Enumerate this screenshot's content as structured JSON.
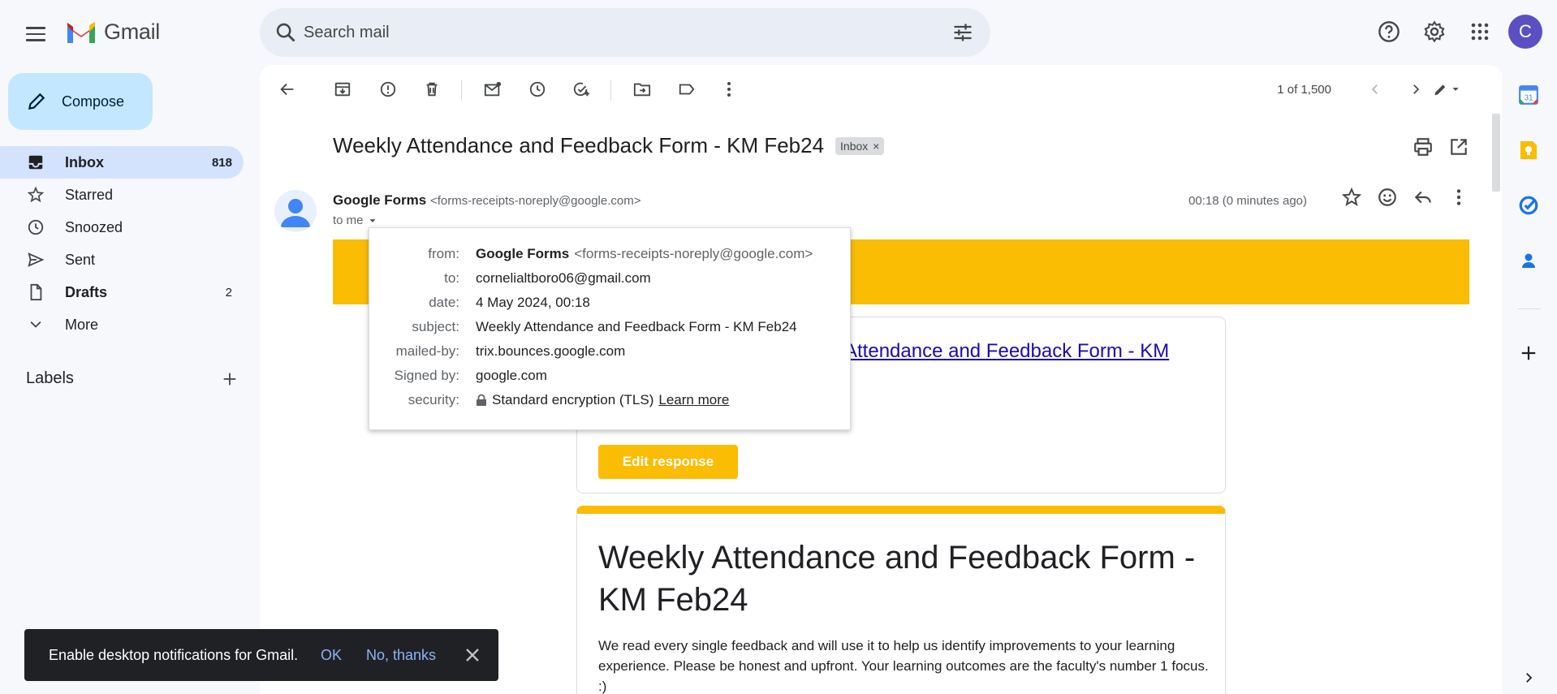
{
  "app": {
    "logo_text": "Gmail"
  },
  "search": {
    "placeholder": "Search mail"
  },
  "account": {
    "initial": "C"
  },
  "compose": {
    "label": "Compose"
  },
  "nav": {
    "items": [
      {
        "label": "Inbox",
        "count": "818",
        "icon": "inbox-icon"
      },
      {
        "label": "Starred",
        "count": "",
        "icon": "star-icon"
      },
      {
        "label": "Snoozed",
        "count": "",
        "icon": "clock-icon"
      },
      {
        "label": "Sent",
        "count": "",
        "icon": "send-icon"
      },
      {
        "label": "Drafts",
        "count": "2",
        "icon": "draft-icon"
      },
      {
        "label": "More",
        "count": "",
        "icon": "chevron-down-icon"
      }
    ],
    "labels_heading": "Labels"
  },
  "toolbar": {
    "pager": "1 of 1,500"
  },
  "email": {
    "subject": "Weekly Attendance and Feedback Form - KM Feb24",
    "label_chip": "Inbox",
    "sender_name": "Google Forms",
    "sender_email": "<forms-receipts-noreply@google.com>",
    "to_line": "to me",
    "time": "00:18 (0 minutes ago)",
    "link_text": "Attendance and Feedback Form - KM",
    "edit_button": "Edit response",
    "form_title": "Weekly Attendance and Feedback Form - KM Feb24",
    "form_description": "We read every single feedback and will use it to help us identify improvements to your learning experience. Please be honest and upfront. Your learning outcomes are the faculty's number 1 focus. :)"
  },
  "details": {
    "from_label": "from:",
    "from_name": "Google Forms",
    "from_email": "<forms-receipts-noreply@google.com>",
    "to_label": "to:",
    "to_value": "cornelialtboro06@gmail.com",
    "date_label": "date:",
    "date_value": "4 May 2024, 00:18",
    "subject_label": "subject:",
    "subject_value": "Weekly Attendance and Feedback Form - KM Feb24",
    "mailed_by_label": "mailed-by:",
    "mailed_by_value": "trix.bounces.google.com",
    "signed_by_label": "Signed by:",
    "signed_by_value": "google.com",
    "security_label": "security:",
    "security_value": "Standard encryption (TLS)",
    "learn_more": "Learn more"
  },
  "snackbar": {
    "message": "Enable desktop notifications for Gmail.",
    "ok": "OK",
    "no_thanks": "No, thanks"
  },
  "colors": {
    "accent_yellow": "#fbbc04",
    "compose_bg": "#c2e7ff",
    "nav_active": "#d3e3fd",
    "avatar": "#5b4fc3"
  }
}
